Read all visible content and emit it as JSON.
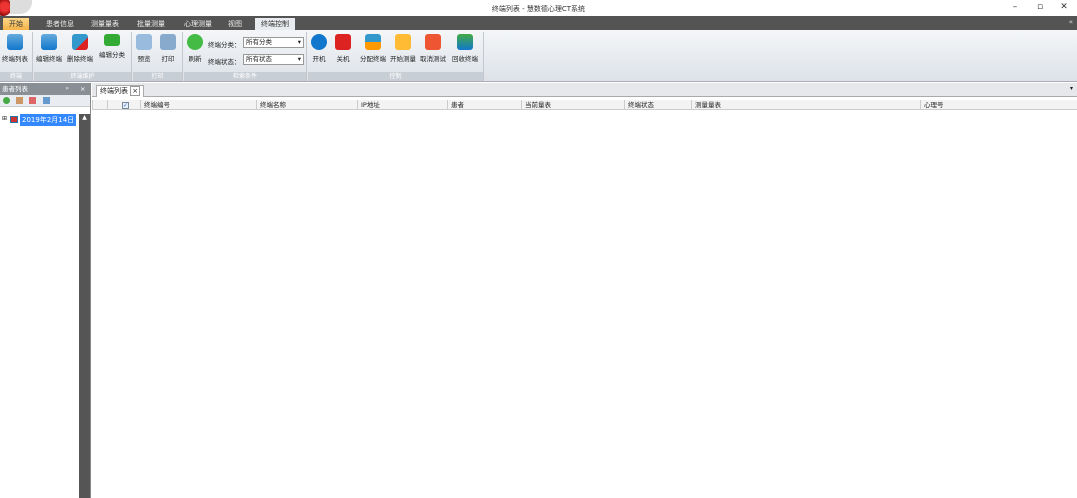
{
  "window": {
    "title": "终端列表 - 慧数德心理CT系统"
  },
  "tabs": [
    "开始",
    "患者信息",
    "测量量表",
    "批量测量",
    "心理测量",
    "视图",
    "终端控制"
  ],
  "ribbon": {
    "groups": {
      "terminal": "终端",
      "maintain": "终端维护",
      "print": "打印",
      "filter": "检索条件",
      "control": "控制"
    },
    "buttons": {
      "list": "终端列表",
      "edit": "编辑终端",
      "delete": "删除终端",
      "edit_cat": "编辑分类",
      "preview": "预览",
      "print": "打印",
      "refresh": "刷新",
      "power_on": "开机",
      "power_off": "关机",
      "assign": "分配终端",
      "start": "开始测量",
      "cancel": "取消测试",
      "recycle": "回收终端"
    },
    "filters": {
      "category_label": "终端分类：",
      "category_value": "所有分类",
      "status_label": "终端状态：",
      "status_value": "所有状态"
    }
  },
  "left_panel": {
    "title": "患者列表",
    "tree_item": "2019年2月14日"
  },
  "main": {
    "doc_tab": "终端列表",
    "columns": [
      "终端编号",
      "终端名称",
      "IP地址",
      "患者",
      "当前量表",
      "终端状态",
      "测量量表",
      "心理号"
    ]
  }
}
